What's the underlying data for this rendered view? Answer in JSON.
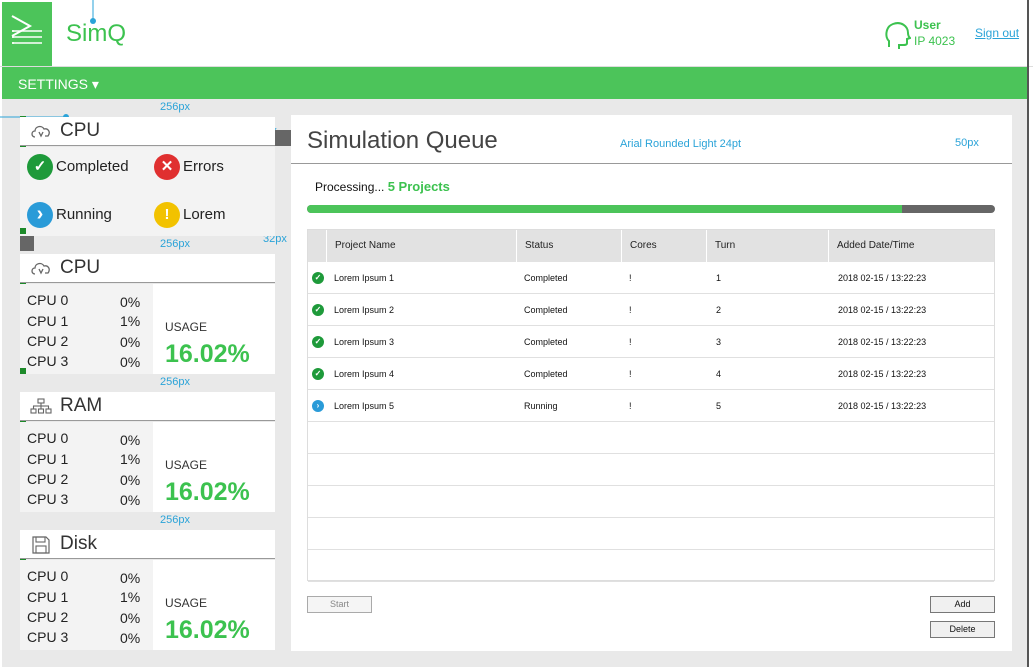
{
  "header": {
    "app_title": "SimQ",
    "user_name": "User",
    "user_ip": "IP 4023",
    "sign_out": "Sign out"
  },
  "settings_bar": {
    "label": "SETTINGS ▾"
  },
  "annotations": {
    "dim_256": "256px",
    "dim_32": "32px",
    "dim_50": "50px",
    "font_note": "Arial Rounded Light 24pt"
  },
  "status_panel": {
    "title": "CPU",
    "items": [
      {
        "label": "Completed",
        "color": "#1e9a3a",
        "glyph": "✓"
      },
      {
        "label": "Errors",
        "color": "#e03030",
        "glyph": "✕"
      },
      {
        "label": "Running",
        "color": "#2a9bd8",
        "glyph": "›"
      },
      {
        "label": "Lorem",
        "color": "#f2c200",
        "glyph": "!"
      }
    ]
  },
  "resource_panels": [
    {
      "title": "CPU",
      "icon": "cloud-icon",
      "rows": [
        {
          "name": "CPU 0",
          "pct": "0%"
        },
        {
          "name": "CPU 1",
          "pct": "1%"
        },
        {
          "name": "CPU 2",
          "pct": "0%"
        },
        {
          "name": "CPU 3",
          "pct": "0%"
        }
      ],
      "usage_label": "USAGE",
      "usage_value": "16.02%"
    },
    {
      "title": "RAM",
      "icon": "network-icon",
      "rows": [
        {
          "name": "CPU 0",
          "pct": "0%"
        },
        {
          "name": "CPU 1",
          "pct": "1%"
        },
        {
          "name": "CPU 2",
          "pct": "0%"
        },
        {
          "name": "CPU 3",
          "pct": "0%"
        }
      ],
      "usage_label": "USAGE",
      "usage_value": "16.02%"
    },
    {
      "title": "Disk",
      "icon": "disk-icon",
      "rows": [
        {
          "name": "CPU 0",
          "pct": "0%"
        },
        {
          "name": "CPU 1",
          "pct": "1%"
        },
        {
          "name": "CPU 2",
          "pct": "0%"
        },
        {
          "name": "CPU 3",
          "pct": "0%"
        }
      ],
      "usage_label": "USAGE",
      "usage_value": "16.02%"
    }
  ],
  "queue": {
    "title": "Simulation Queue",
    "processing_prefix": "Processing...",
    "processing_count": "5 Projects",
    "progress": 0.865,
    "columns": [
      "Project Name",
      "Status",
      "Cores",
      "Turn",
      "Added Date/Time"
    ],
    "rows": [
      {
        "name": "Lorem Ipsum 1",
        "status": "Completed",
        "cores": "!",
        "turn": "1",
        "added": "2018 02-15 / 13:22:23",
        "state": "completed"
      },
      {
        "name": "Lorem Ipsum 2",
        "status": "Completed",
        "cores": "!",
        "turn": "2",
        "added": "2018 02-15 / 13:22:23",
        "state": "completed"
      },
      {
        "name": "Lorem Ipsum 3",
        "status": "Completed",
        "cores": "!",
        "turn": "3",
        "added": "2018 02-15 / 13:22:23",
        "state": "completed"
      },
      {
        "name": "Lorem Ipsum 4",
        "status": "Completed",
        "cores": "!",
        "turn": "4",
        "added": "2018 02-15 / 13:22:23",
        "state": "completed"
      },
      {
        "name": "Lorem Ipsum 5",
        "status": "Running",
        "cores": "!",
        "turn": "5",
        "added": "2018 02-15 / 13:22:23",
        "state": "running"
      }
    ],
    "empty_rows": 5,
    "buttons": {
      "start": "Start",
      "add": "Add",
      "delete": "Delete"
    }
  },
  "colors": {
    "brand_green": "#4cc45a",
    "accent_blue": "#2aa3d8",
    "completed": "#1e9a3a",
    "running": "#2a9bd8"
  }
}
